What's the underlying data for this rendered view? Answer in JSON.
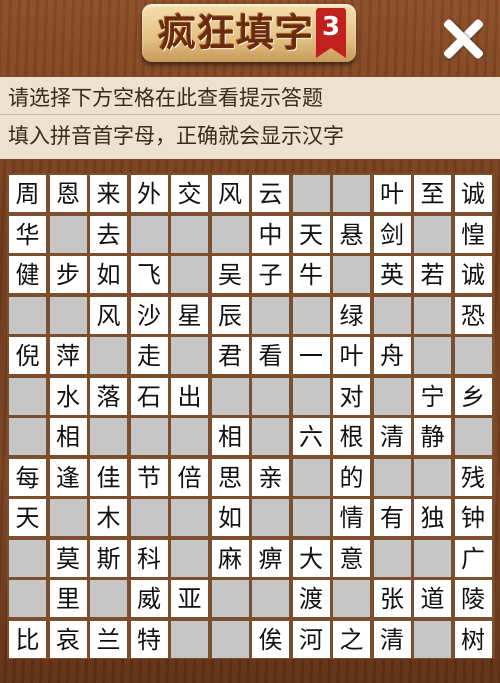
{
  "header": {
    "title": "疯狂填字",
    "level": "3",
    "close_icon": "close-icon"
  },
  "hint": {
    "line1": "请选择下方空格在此查看提示答题",
    "line2": "填入拼音首字母，正确就会显示汉字"
  },
  "board": {
    "columns": 12,
    "rows": [
      [
        "周",
        "恩",
        "来",
        "外",
        "交",
        "风",
        "云",
        "#",
        "#",
        "叶",
        "至",
        "诚"
      ],
      [
        "华",
        "#",
        "去",
        "",
        "",
        "",
        "中",
        "天",
        "悬",
        "剑",
        "",
        "惶"
      ],
      [
        "健",
        "步",
        "如",
        "飞",
        "#",
        "吴",
        "子",
        "牛",
        "",
        "英",
        "若",
        "诚"
      ],
      [
        "",
        "",
        "风",
        "沙",
        "星",
        "辰",
        "",
        "",
        "绿",
        "",
        "",
        "恐"
      ],
      [
        "倪",
        "萍",
        "",
        "走",
        "",
        "君",
        "看",
        "一",
        "叶",
        "舟",
        "",
        ""
      ],
      [
        "",
        "水",
        "落",
        "石",
        "出",
        "",
        "",
        "",
        "对",
        "",
        "宁",
        "乡"
      ],
      [
        "",
        "相",
        "",
        "",
        "",
        "相",
        "",
        "六",
        "根",
        "清",
        "静",
        ""
      ],
      [
        "每",
        "逢",
        "佳",
        "节",
        "倍",
        "思",
        "亲",
        "",
        "的",
        "",
        "",
        "残"
      ],
      [
        "天",
        "",
        "木",
        "",
        "",
        "如",
        "",
        "",
        "情",
        "有",
        "独",
        "钟"
      ],
      [
        "",
        "莫",
        "斯",
        "科",
        "",
        "麻",
        "痹",
        "大",
        "意",
        "",
        "",
        "广"
      ],
      [
        "",
        "里",
        "",
        "威",
        "亚",
        "",
        "",
        "渡",
        "",
        "张",
        "道",
        "陵"
      ],
      [
        "比",
        "哀",
        "兰",
        "特",
        "",
        "",
        "俟",
        "河",
        "之",
        "清",
        "",
        "树"
      ]
    ],
    "whites": [
      [
        1,
        1,
        1,
        1,
        1,
        1,
        1,
        0,
        0,
        1,
        1,
        1
      ],
      [
        1,
        0,
        1,
        0,
        0,
        0,
        1,
        1,
        1,
        1,
        0,
        1
      ],
      [
        1,
        1,
        1,
        1,
        0,
        1,
        1,
        1,
        0,
        1,
        1,
        1
      ],
      [
        0,
        0,
        1,
        1,
        1,
        1,
        0,
        0,
        1,
        0,
        0,
        1
      ],
      [
        1,
        1,
        0,
        1,
        0,
        1,
        1,
        1,
        1,
        1,
        0,
        0
      ],
      [
        0,
        1,
        1,
        1,
        1,
        0,
        0,
        0,
        1,
        0,
        1,
        1
      ],
      [
        0,
        1,
        0,
        0,
        0,
        1,
        0,
        1,
        1,
        1,
        1,
        0
      ],
      [
        1,
        1,
        1,
        1,
        1,
        1,
        1,
        0,
        1,
        0,
        0,
        1
      ],
      [
        1,
        0,
        1,
        0,
        0,
        1,
        0,
        0,
        1,
        1,
        1,
        1
      ],
      [
        0,
        1,
        1,
        1,
        0,
        1,
        1,
        1,
        1,
        0,
        0,
        1
      ],
      [
        0,
        1,
        0,
        1,
        1,
        0,
        0,
        1,
        0,
        1,
        1,
        1
      ],
      [
        1,
        1,
        1,
        1,
        0,
        0,
        1,
        1,
        1,
        1,
        0,
        1
      ]
    ]
  }
}
